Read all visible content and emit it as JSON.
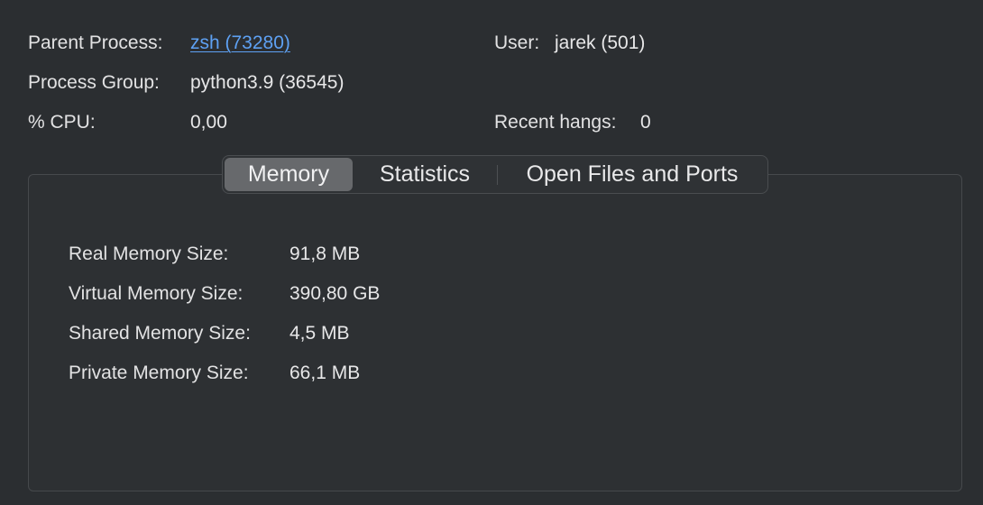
{
  "info": {
    "parent_process_label": "Parent Process:",
    "parent_process_value": "zsh (73280)",
    "user_label": "User:",
    "user_value": "jarek (501)",
    "process_group_label": "Process Group:",
    "process_group_value": "python3.9 (36545)",
    "cpu_label": "% CPU:",
    "cpu_value": "0,00",
    "recent_hangs_label": "Recent hangs:",
    "recent_hangs_value": "0"
  },
  "tabs": [
    {
      "label": "Memory",
      "selected": true
    },
    {
      "label": "Statistics",
      "selected": false
    },
    {
      "label": "Open Files and Ports",
      "selected": false
    }
  ],
  "memory": [
    {
      "label": "Real Memory Size:",
      "value": "91,8 MB"
    },
    {
      "label": "Virtual Memory Size:",
      "value": "390,80 GB"
    },
    {
      "label": "Shared Memory Size:",
      "value": "4,5 MB"
    },
    {
      "label": "Private Memory Size:",
      "value": "66,1 MB"
    }
  ],
  "colors": {
    "background": "#2b2e31",
    "link": "#5ea1f3",
    "selected_tab": "#67696c"
  }
}
